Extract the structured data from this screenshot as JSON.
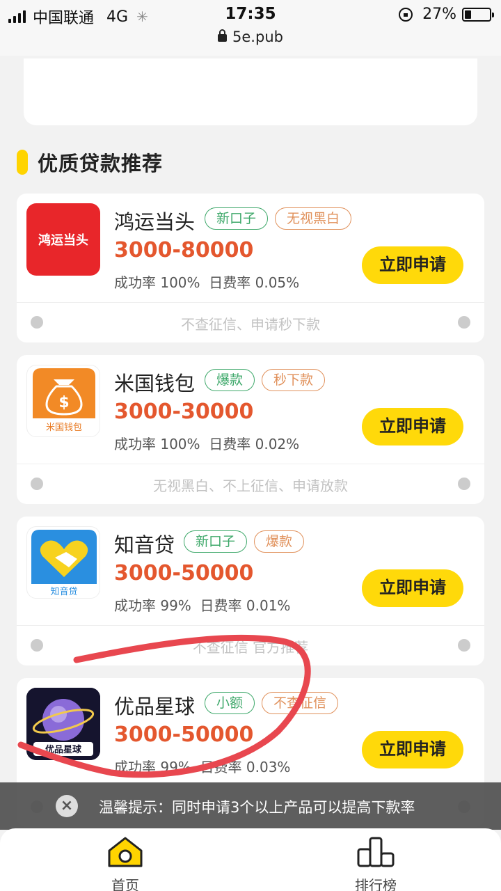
{
  "status_bar": {
    "carrier": "中国联通",
    "network": "4G",
    "time": "17:35",
    "battery": "27%",
    "battery_level": 0.27
  },
  "address_bar": {
    "url": "5e.pub"
  },
  "section": {
    "title": "优质贷款推荐"
  },
  "products": [
    {
      "name": "鸿运当头",
      "logo_text": "鸿运当头",
      "tags": [
        {
          "label": "新口子",
          "color": "green"
        },
        {
          "label": "无视黑白",
          "color": "orange"
        }
      ],
      "amount": "3000-80000",
      "success_rate": "成功率 100%",
      "daily_rate": "日费率 0.05%",
      "apply_label": "立即申请",
      "note": "不查征信、申请秒下款"
    },
    {
      "name": "米国钱包",
      "logo_text": "米国钱包",
      "tags": [
        {
          "label": "爆款",
          "color": "green"
        },
        {
          "label": "秒下款",
          "color": "orange"
        }
      ],
      "amount": "3000-30000",
      "success_rate": "成功率 100%",
      "daily_rate": "日费率 0.02%",
      "apply_label": "立即申请",
      "note": "无视黑白、不上征信、申请放款"
    },
    {
      "name": "知音贷",
      "logo_text": "知音贷",
      "tags": [
        {
          "label": "新口子",
          "color": "green"
        },
        {
          "label": "爆款",
          "color": "orange"
        }
      ],
      "amount": "3000-50000",
      "success_rate": "成功率 99%",
      "daily_rate": "日费率 0.01%",
      "apply_label": "立即申请",
      "note": "不查征信 官方推荐"
    },
    {
      "name": "优品星球",
      "logo_text": "优品星球",
      "tags": [
        {
          "label": "小额",
          "color": "green"
        },
        {
          "label": "不查征信",
          "color": "orange"
        }
      ],
      "amount": "3000-50000",
      "success_rate": "成功率 99%",
      "daily_rate": "日费率 0.03%",
      "apply_label": "立即申请",
      "note": ""
    }
  ],
  "toast": {
    "message": "温馨提示：同时申请3个以上产品可以提高下款率"
  },
  "tabbar": {
    "home_label": "首页",
    "rank_label": "排行榜"
  },
  "colors": {
    "accent": "#ffd90a",
    "amount": "#e4572e",
    "tag_green": "#3ea86a",
    "tag_orange": "#e0905a",
    "annotation": "#e8474f"
  }
}
